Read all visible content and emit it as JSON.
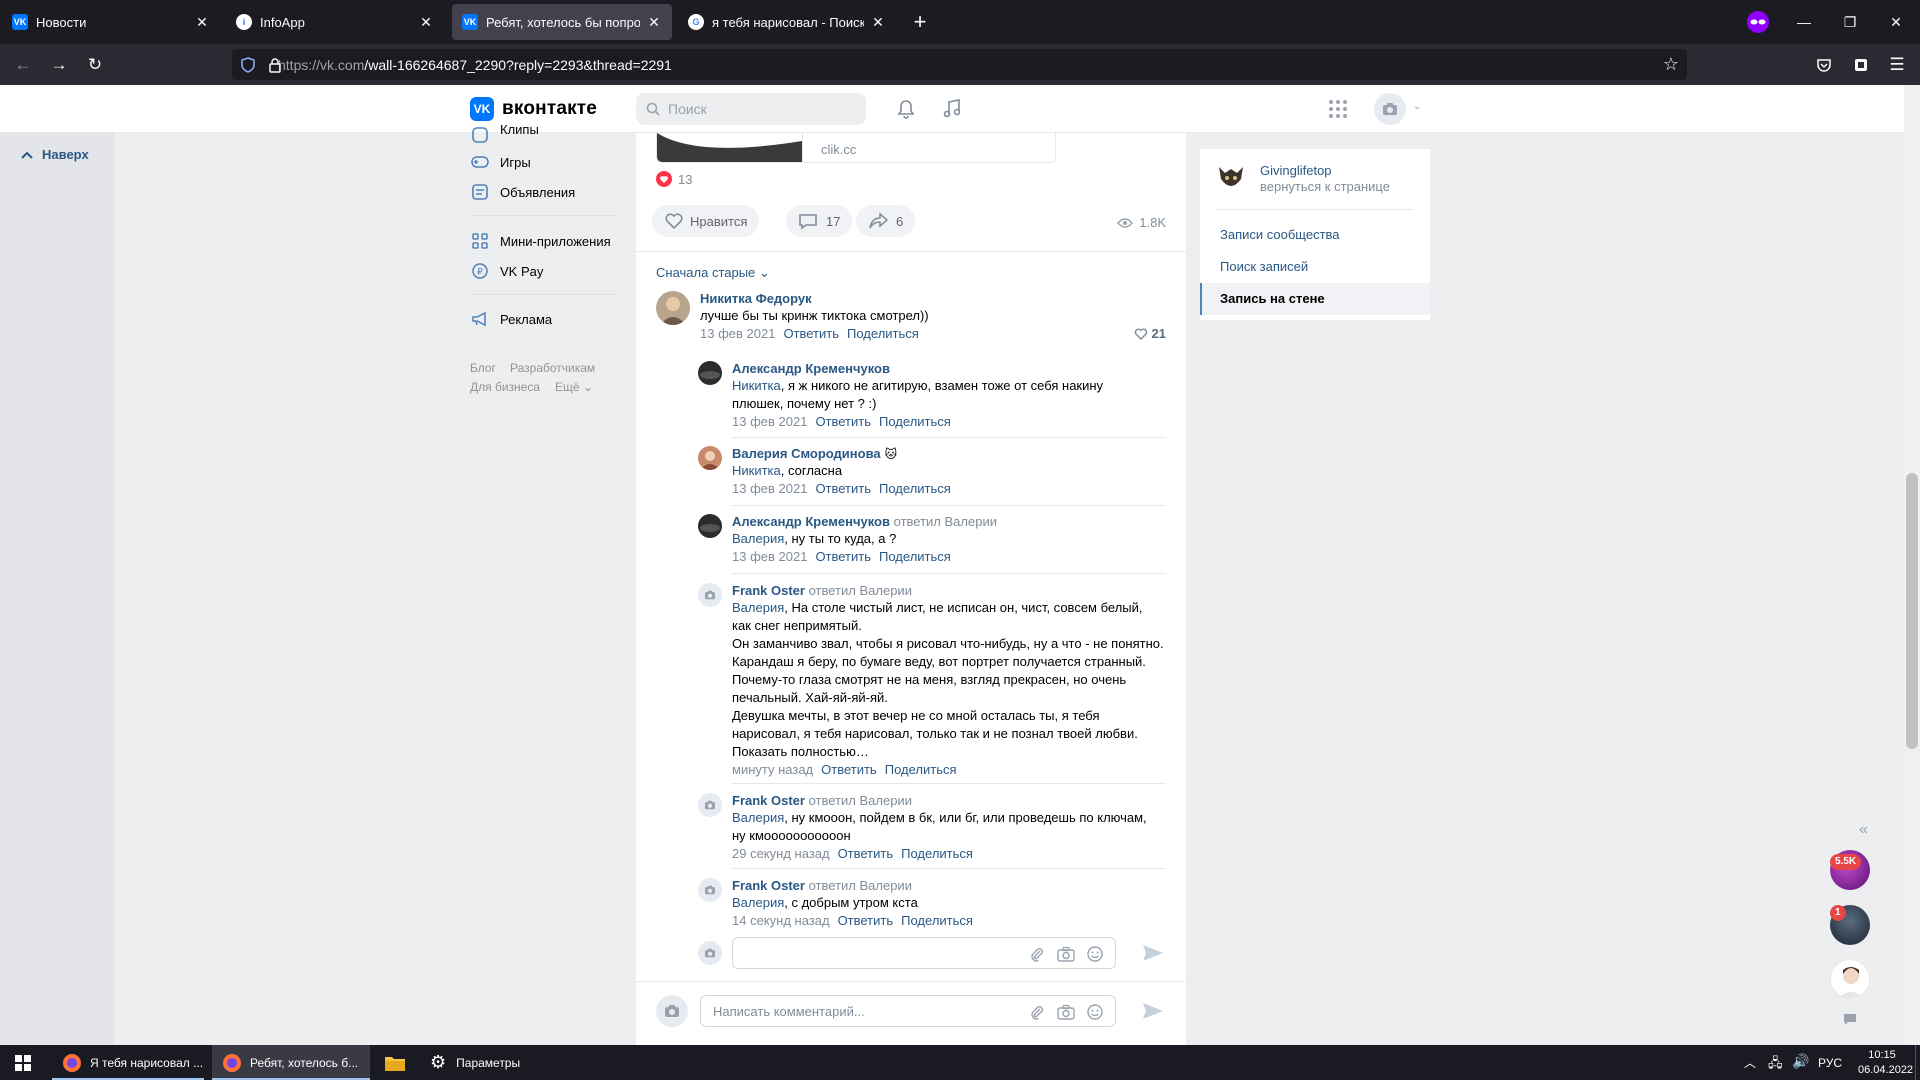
{
  "browser": {
    "tabs": [
      {
        "title": "Новости",
        "favicon": "vk"
      },
      {
        "title": "InfoApp",
        "favicon": "info"
      },
      {
        "title": "Ребят, хотелось бы попросить",
        "favicon": "vk"
      },
      {
        "title": "я тебя нарисовал - Поиск в Go",
        "favicon": "google"
      }
    ],
    "url_host": "https://vk.com",
    "url_path": "/wall-166264687_2290?reply=2293&thread=2291"
  },
  "vk": {
    "logo_text": "вконтакте",
    "search_placeholder": "Поиск",
    "back_to_top": "Наверх",
    "menu": [
      {
        "label": "Клипы",
        "icon": "clips-icon"
      },
      {
        "label": "Игры",
        "icon": "games-icon"
      },
      {
        "label": "Объявления",
        "icon": "ads-icon"
      },
      {
        "label": "Мини-приложения",
        "icon": "apps-icon"
      },
      {
        "label": "VK Pay",
        "icon": "vkpay-icon"
      },
      {
        "label": "Реклама",
        "icon": "megaphone-icon"
      }
    ],
    "footer": [
      "Блог",
      "Разработчикам",
      "Для бизнеса",
      "Ещё"
    ]
  },
  "post": {
    "attachment_domain": "clik.cc",
    "reactions_count": "13",
    "like_label": "Нравится",
    "comments_count": "17",
    "shares_count": "6",
    "views_count": "1.8K",
    "sort_label": "Сначала старые"
  },
  "comments": [
    {
      "author": "Никитка Федорук",
      "text": "лучше бы ты кринж тиктока смотрел))",
      "date": "13 фев 2021",
      "reply": "Ответить",
      "share": "Поделиться",
      "likes": "21"
    },
    {
      "author": "Александр Кременчуков",
      "mention": "Никитка",
      "text": ", я ж никого не агитирую, взамен тоже от себя накину",
      "text2": "плюшек, почему нет ? :)",
      "date": "13 фев 2021",
      "reply": "Ответить",
      "share": "Поделиться"
    },
    {
      "author": "Валерия Смородинова",
      "mention": "Никитка",
      "text": ", согласна",
      "date": "13 фев 2021",
      "reply": "Ответить",
      "share": "Поделиться"
    },
    {
      "author": "Александр Кременчуков",
      "replied_to": "ответил Валерии",
      "mention": "Валерия",
      "text": ", ну ты то куда, а ?",
      "date": "13 фев 2021",
      "reply": "Ответить",
      "share": "Поделиться"
    },
    {
      "author": "Frank Oster",
      "replied_to": "ответил Валерии",
      "mention": "Валерия",
      "lines": [
        ", На столе чистый лист, не исписан он, чист, совсем белый,",
        "как снег непримятый.",
        "Он заманчиво звал, чтобы я рисовал что-нибудь, ну а что - не понятно.",
        "Карандаш я беру, по бумаге веду, вот портрет получается странный.",
        "Почему-то глаза смотрят не на меня, взгляд прекрасен, но очень",
        "печальный. Хай-яй-яй-яй.",
        "Девушка мечты, в этот вечер не со мной осталась ты, я тебя",
        "нарисовал, я тебя нарисовал, только так и не познал твоей любви."
      ],
      "show_more": "Показать полностью…",
      "date": "минуту назад",
      "reply": "Ответить",
      "share": "Поделиться"
    },
    {
      "author": "Frank Oster",
      "replied_to": "ответил Валерии",
      "mention": "Валерия",
      "text": ", ну кмооон, пойдем в бк, или бг, или проведешь по ключам,",
      "text2": "ну кмооооооооооон",
      "date": "29 секунд назад",
      "reply": "Ответить",
      "share": "Поделиться"
    },
    {
      "author": "Frank Oster",
      "replied_to": "ответил Валерии",
      "mention": "Валерия",
      "text": ", с добрым утром кста",
      "date": "14 секунд назад",
      "reply": "Ответить",
      "share": "Поделиться"
    }
  ],
  "comment_input_placeholder": "Написать комментарий...",
  "sidebar": {
    "group_name": "Givinglifetop",
    "group_sub": "вернуться к странице",
    "links": [
      "Записи сообщества",
      "Поиск записей",
      "Запись на стене"
    ]
  },
  "float": {
    "badge1": "5.5K",
    "badge2": "1"
  },
  "taskbar": {
    "items": [
      "Я тебя нарисовал ...",
      "Ребят, хотелось б...",
      "Параметры"
    ],
    "lang": "РУС",
    "time": "10:15",
    "date": "06.04.2022"
  }
}
